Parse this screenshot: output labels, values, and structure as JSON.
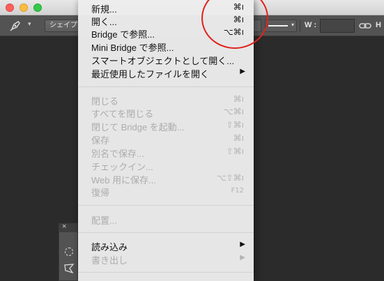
{
  "options_bar": {
    "shape_mode_label": "シェイプ",
    "width_label": "W :",
    "height_label": "H",
    "icons": [
      "pen-tool-icon",
      "chevron-down-icon",
      "link-icon"
    ]
  },
  "tools_panel": {
    "close_label": "×",
    "icons": [
      "elliptical-marquee-icon",
      "polygonal-lasso-icon"
    ]
  },
  "menu": {
    "items": [
      {
        "label": "新規...",
        "shortcut": "⌘ı",
        "enabled": true
      },
      {
        "label": "開く...",
        "shortcut": "⌘ı",
        "enabled": true
      },
      {
        "label": "Bridge で参照...",
        "shortcut": "⌥⌘ı",
        "enabled": true
      },
      {
        "label": "Mini Bridge で参照...",
        "shortcut": "",
        "enabled": true
      },
      {
        "label": "スマートオブジェクトとして開く...",
        "shortcut": "",
        "enabled": true
      },
      {
        "label": "最近使用したファイルを開く",
        "submenu": "▶",
        "enabled": true
      },
      {
        "label": "閉じる",
        "shortcut": "⌘ı",
        "enabled": false
      },
      {
        "label": "すべてを閉じる",
        "shortcut": "⌥⌘ı",
        "enabled": false
      },
      {
        "label": "閉じて Bridge を起動...",
        "shortcut": "⇧⌘ı",
        "enabled": false
      },
      {
        "label": "保存",
        "shortcut": "⌘ı",
        "enabled": false
      },
      {
        "label": "別名で保存...",
        "shortcut": "⇧⌘ı",
        "enabled": false
      },
      {
        "label": "チェックイン...",
        "shortcut": "",
        "enabled": false
      },
      {
        "label": "Web 用に保存...",
        "shortcut": "⌥⇧⌘ı",
        "enabled": false
      },
      {
        "label": "復帰",
        "shortcut": "F12",
        "enabled": false
      },
      {
        "label": "配置...",
        "shortcut": "",
        "enabled": false
      },
      {
        "label": "読み込み",
        "submenu": "▶",
        "enabled": true
      },
      {
        "label": "書き出し",
        "submenu": "▶",
        "enabled": false
      }
    ]
  },
  "colors": {
    "annotation_circle": "#e0211a",
    "menu_background": "#ececec",
    "disabled_text": "#acacac",
    "workspace_background": "#2b2b2b"
  }
}
